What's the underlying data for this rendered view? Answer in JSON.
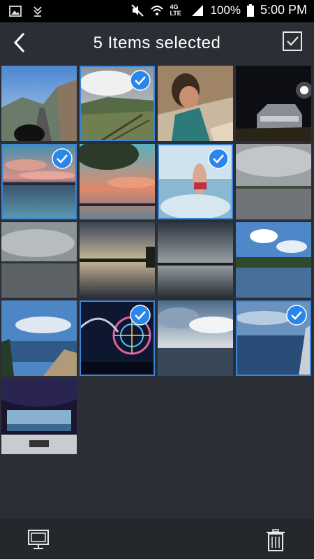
{
  "status": {
    "lte": "4G LTE",
    "battery": "100%",
    "time": "5:00 PM"
  },
  "header": {
    "title": "5 Items selected"
  },
  "grid": {
    "items": [
      {
        "selected": false
      },
      {
        "selected": true
      },
      {
        "selected": false
      },
      {
        "selected": false
      },
      {
        "selected": true
      },
      {
        "selected": false
      },
      {
        "selected": true
      },
      {
        "selected": false
      },
      {
        "selected": false
      },
      {
        "selected": false
      },
      {
        "selected": false
      },
      {
        "selected": false
      },
      {
        "selected": false
      },
      {
        "selected": true
      },
      {
        "selected": false
      },
      {
        "selected": true
      },
      {
        "selected": false
      }
    ]
  },
  "colors": {
    "background": "#2b2f35",
    "accent": "#3b84d6",
    "check": "#2a86e8"
  }
}
